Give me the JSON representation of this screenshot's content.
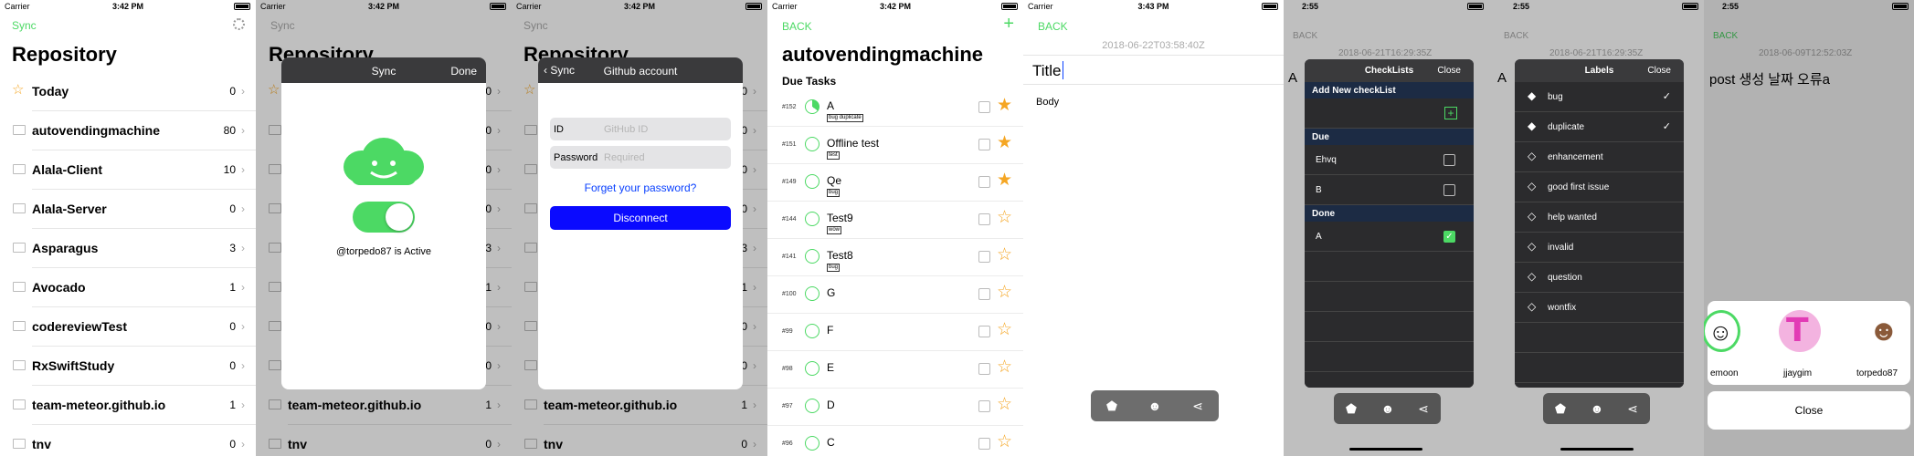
{
  "status": {
    "carrier": "Carrier",
    "t1": "3:42 PM",
    "t2": "3:43 PM",
    "t3": "2:55"
  },
  "repo": {
    "sync": "Sync",
    "title": "Repository",
    "rows": [
      {
        "name": "Today",
        "count": "0",
        "icon": "star-icon"
      },
      {
        "name": "autovendingmachine",
        "count": "80",
        "icon": "folder-icon"
      },
      {
        "name": "Alala-Client",
        "count": "10",
        "icon": "folder-icon"
      },
      {
        "name": "Alala-Server",
        "count": "0",
        "icon": "folder-icon"
      },
      {
        "name": "Asparagus",
        "count": "3",
        "icon": "folder-icon"
      },
      {
        "name": "Avocado",
        "count": "1",
        "icon": "folder-icon"
      },
      {
        "name": "codereviewTest",
        "count": "0",
        "icon": "folder-icon"
      },
      {
        "name": "RxSwiftStudy",
        "count": "0",
        "icon": "folder-icon"
      },
      {
        "name": "team-meteor.github.io",
        "count": "1",
        "icon": "folder-icon"
      },
      {
        "name": "tnv",
        "count": "0",
        "icon": "folder-icon"
      }
    ]
  },
  "syncModal": {
    "title": "Sync",
    "done": "Done",
    "status": "@torpedo87 is Active",
    "toggle_on": true
  },
  "githubModal": {
    "back": "Sync",
    "title": "Github account",
    "id_label": "ID",
    "id_placeholder": "GitHub ID",
    "pw_label": "Password",
    "pw_placeholder": "Required",
    "forgot": "Forget your password?",
    "disconnect": "Disconnect"
  },
  "tasks": {
    "back": "BACK",
    "add": "+",
    "title": "autovendingmachine",
    "section": "Due Tasks",
    "items": [
      {
        "num": "#152",
        "name": "A",
        "badges": "bug duplicate",
        "starred": true
      },
      {
        "num": "#151",
        "name": "Offline test",
        "badges": "test",
        "starred": true
      },
      {
        "num": "#149",
        "name": "Qe",
        "badges": "bug",
        "starred": true
      },
      {
        "num": "#144",
        "name": "Test9",
        "badges": "wow",
        "starred": false
      },
      {
        "num": "#141",
        "name": "Test8",
        "badges": "bug",
        "starred": false
      },
      {
        "num": "#100",
        "name": "G",
        "badges": "",
        "starred": false
      },
      {
        "num": "#99",
        "name": "F",
        "badges": "",
        "starred": false
      },
      {
        "num": "#98",
        "name": "E",
        "badges": "",
        "starred": false
      },
      {
        "num": "#97",
        "name": "D",
        "badges": "",
        "starred": false
      },
      {
        "num": "#96",
        "name": "C",
        "badges": "",
        "starred": false
      }
    ]
  },
  "editor": {
    "back": "BACK",
    "date": "2018-06-22T03:58:40Z",
    "title_placeholder": "Title",
    "body_placeholder": "Body"
  },
  "checklists": {
    "back": "BACK",
    "date": "2018-06-21T16:29:35Z",
    "side": "A",
    "title": "CheckLists",
    "close": "Close",
    "add_section": "Add New checkList",
    "due_section": "Due",
    "due": [
      {
        "name": "Ehvq",
        "checked": false
      },
      {
        "name": "B",
        "checked": false
      }
    ],
    "done_section": "Done",
    "done": [
      {
        "name": "A",
        "checked": true
      }
    ]
  },
  "labels": {
    "back": "BACK",
    "date": "2018-06-21T16:29:35Z",
    "side": "A",
    "title": "Labels",
    "close": "Close",
    "items": [
      {
        "name": "bug",
        "selected": true
      },
      {
        "name": "duplicate",
        "selected": true
      },
      {
        "name": "enhancement",
        "selected": false
      },
      {
        "name": "good first issue",
        "selected": false
      },
      {
        "name": "help wanted",
        "selected": false
      },
      {
        "name": "invalid",
        "selected": false
      },
      {
        "name": "question",
        "selected": false
      },
      {
        "name": "wontfix",
        "selected": false
      }
    ]
  },
  "assignees": {
    "back": "BACK",
    "date": "2018-06-09T12:52:03Z",
    "title": "post 생성 날짜 오류a",
    "users": [
      "emoon",
      "jjaygim",
      "torpedo87"
    ],
    "close": "Close"
  },
  "colors": {
    "accent": "#4cd964",
    "link": "#0a41ff",
    "star": "#f5a623",
    "toolbar": "#6d6d6d"
  }
}
